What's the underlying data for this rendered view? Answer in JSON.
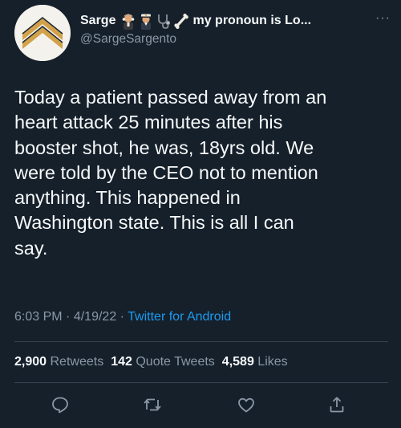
{
  "user": {
    "display_name": "Sarge",
    "name_suffix": "my pronoun is Lo...",
    "handle": "@SargeSargento",
    "emoji_icons": [
      "man-judge-emoji",
      "man-pilot-emoji",
      "stethoscope-emoji",
      "bone-emoji"
    ]
  },
  "tweet": {
    "text": "Today a patient passed away from an\nheart attack 25 minutes after his\nbooster shot, he was, 18yrs old. We\nwere told by the CEO not to mention\nanything. This happened in\nWashington state. This is all I can\nsay.",
    "time": "6:03 PM",
    "separator": "·",
    "date": "4/19/22",
    "source": "Twitter for Android"
  },
  "stats": {
    "retweets_count": "2,900",
    "retweets_label": "Retweets",
    "quotes_count": "142",
    "quotes_label": "Quote Tweets",
    "likes_count": "4,589",
    "likes_label": "Likes"
  },
  "more_icon": "···",
  "colors": {
    "background": "#15202b",
    "text": "#f7f9f9",
    "secondary_text": "#8b98a5",
    "link": "#1d9bf0",
    "divider": "#38444d"
  },
  "actions": [
    "reply-icon",
    "retweet-icon",
    "like-icon",
    "share-icon"
  ]
}
